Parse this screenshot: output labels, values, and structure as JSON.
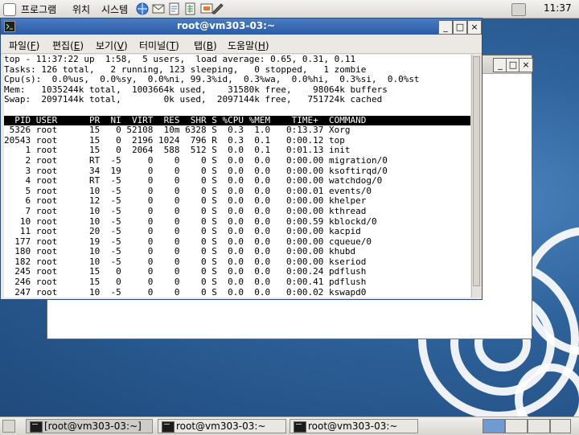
{
  "top_panel": {
    "menus": [
      "프로그램",
      "위치",
      "시스템"
    ],
    "clock": "11:37"
  },
  "terminal": {
    "title": "root@vm303-03:~",
    "menu": [
      {
        "label": "파일(",
        "key": "F",
        "end": ")"
      },
      {
        "label": "편집(",
        "key": "E",
        "end": ")"
      },
      {
        "label": "보기(",
        "key": "V",
        "end": ")"
      },
      {
        "label": "터미널(",
        "key": "T",
        "end": ")"
      },
      {
        "label": "탭(",
        "key": "B",
        "end": ")"
      },
      {
        "label": "도움말(",
        "key": "H",
        "end": ")"
      }
    ],
    "summary": [
      "top - 11:37:22 up  1:58,  5 users,  load average: 0.65, 0.31, 0.11",
      "Tasks: 126 total,   2 running, 123 sleeping,   0 stopped,   1 zombie",
      "Cpu(s):  0.0%us,  0.0%sy,  0.0%ni, 99.3%id,  0.3%wa,  0.0%hi,  0.3%si,  0.0%st",
      "Mem:   1035244k total,  1003664k used,    31580k free,    98064k buffers",
      "Swap:  2097144k total,        0k used,  2097144k free,   751724k cached"
    ],
    "process_header": "  PID USER      PR  NI  VIRT  RES  SHR S %CPU %MEM    TIME+  COMMAND",
    "processes": [
      " 5326 root      15   0 52108  10m 6328 S  0.3  1.0   0:13.37 Xorg",
      "20543 root      15   0  2196 1024  796 R  0.3  0.1   0:00.12 top",
      "    1 root      15   0  2064  588  512 S  0.0  0.1   0:01.13 init",
      "    2 root      RT  -5     0    0    0 S  0.0  0.0   0:00.00 migration/0",
      "    3 root      34  19     0    0    0 S  0.0  0.0   0:00.00 ksoftirqd/0",
      "    4 root      RT  -5     0    0    0 S  0.0  0.0   0:00.00 watchdog/0",
      "    5 root      10  -5     0    0    0 S  0.0  0.0   0:00.01 events/0",
      "    6 root      12  -5     0    0    0 S  0.0  0.0   0:00.00 khelper",
      "    7 root      10  -5     0    0    0 S  0.0  0.0   0:00.00 kthread",
      "   10 root      10  -5     0    0    0 S  0.0  0.0   0:00.59 kblockd/0",
      "   11 root      20  -5     0    0    0 S  0.0  0.0   0:00.00 kacpid",
      "  177 root      19  -5     0    0    0 S  0.0  0.0   0:00.00 cqueue/0",
      "  180 root      10  -5     0    0    0 S  0.0  0.0   0:00.00 khubd",
      "  182 root      10  -5     0    0    0 S  0.0  0.0   0:00.00 kseriod",
      "  245 root      15   0     0    0    0 S  0.0  0.0   0:00.24 pdflush",
      "  246 root      15   0     0    0    0 S  0.0  0.0   0:00.41 pdflush",
      "  247 root      10  -5     0    0    0 S  0.0  0.0   0:00.02 kswapd0"
    ]
  },
  "taskbar": {
    "tasks": [
      "[root@vm303-03:~]",
      "root@vm303-03:~",
      "root@vm303-03:~"
    ]
  },
  "colors": {
    "titlebar_active": "#2a5ba5",
    "desktop": "#2f639c",
    "terminal_bg": "#ffffff",
    "header_row_bg": "#000000"
  }
}
